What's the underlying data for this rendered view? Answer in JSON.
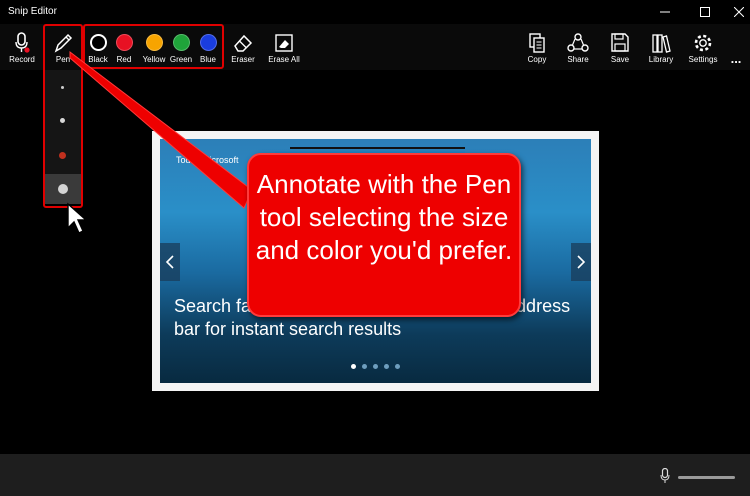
{
  "window": {
    "title": "Snip Editor"
  },
  "toolbar": {
    "record_label": "Record",
    "pen_label": "Pen",
    "colors": [
      {
        "label": "Black",
        "color": "#000000",
        "ring": true
      },
      {
        "label": "Red",
        "color": "#e81123"
      },
      {
        "label": "Yellow",
        "color": "#f7a400"
      },
      {
        "label": "Green",
        "color": "#1fa43a"
      },
      {
        "label": "Blue",
        "color": "#1a3dde"
      }
    ],
    "eraser_label": "Eraser",
    "erase_all_label": "Erase All",
    "copy_label": "Copy",
    "share_label": "Share",
    "save_label": "Save",
    "library_label": "Library",
    "settings_label": "Settings",
    "more_label": "..."
  },
  "pen_sizes": [
    {
      "name": "pen-size-1",
      "color": "#cccccc"
    },
    {
      "name": "pen-size-2",
      "color": "#d8d8d8"
    },
    {
      "name": "pen-size-3",
      "color": "#c0301e"
    },
    {
      "name": "pen-size-4",
      "color": "#d4d4d4",
      "selected": true
    }
  ],
  "snip": {
    "tag": "Tod… Microsoft",
    "headline": "Search fa… …ddress bar for instant search results",
    "headline_line1": "Search fa",
    "headline_line1_end": "ddress",
    "headline_line2": "bar for instant search results",
    "dot_count": 5
  },
  "callout": {
    "text": "Annotate with the Pen tool selecting the size and color you'd prefer."
  },
  "accent": "#e00000"
}
